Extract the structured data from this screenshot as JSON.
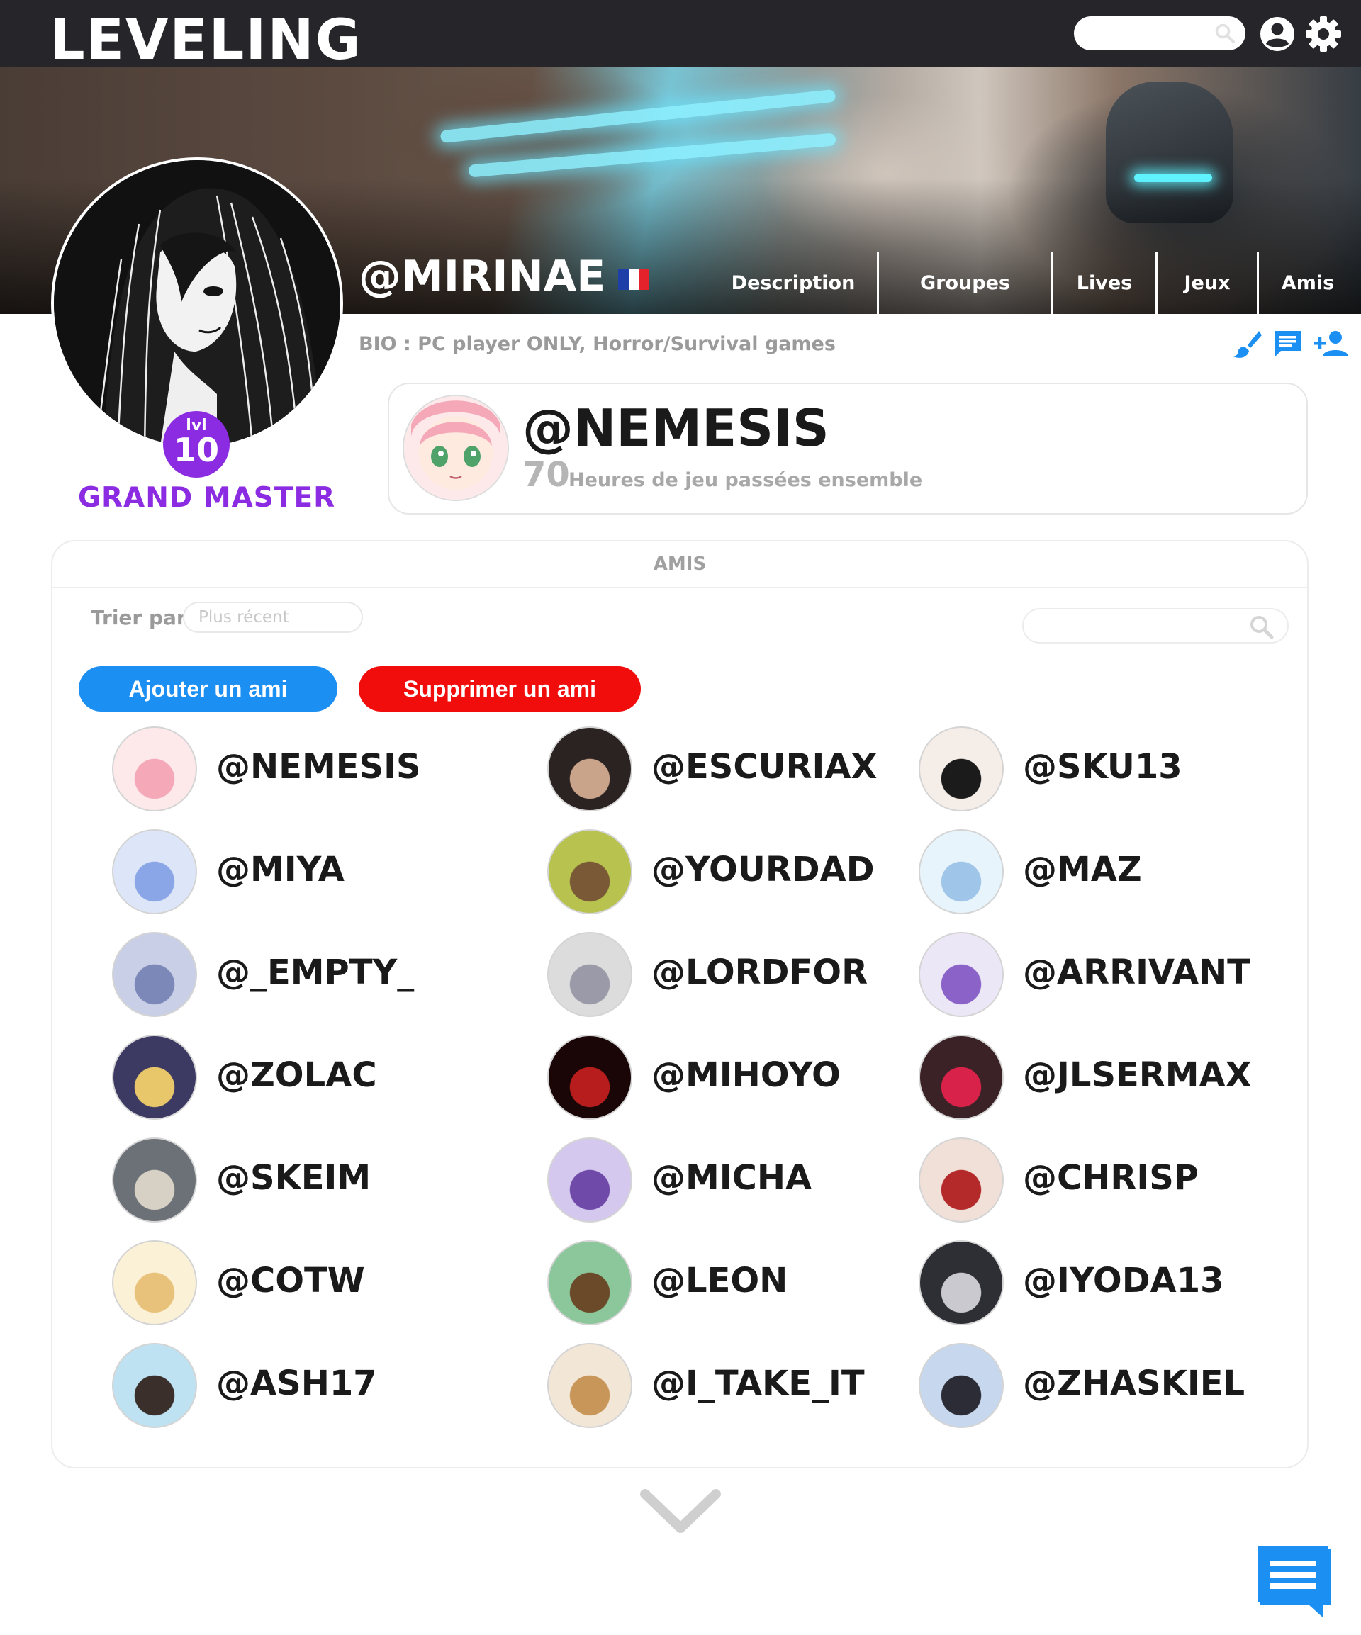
{
  "app": {
    "logo": "LEVELING"
  },
  "topbar": {
    "search_icon": "search-icon",
    "account_icon": "account-icon",
    "settings_icon": "gear-icon"
  },
  "profile": {
    "username": "@MIRINAE",
    "country_flag": "france-flag",
    "bio": "BIO : PC player ONLY, Horror/Survival games",
    "level_prefix": "lvl",
    "level": "10",
    "rank": "GRAND MASTER",
    "rank_color": "#8b2be2"
  },
  "nav": {
    "tabs": [
      {
        "label": "Description"
      },
      {
        "label": "Groupes"
      },
      {
        "label": "Lives"
      },
      {
        "label": "Jeux"
      },
      {
        "label": "Amis"
      }
    ]
  },
  "actions": {
    "edit_icon": "brush-icon",
    "message_icon": "message-icon",
    "add_friend_icon": "add-person-icon",
    "accent": "#1b8ff2"
  },
  "best_mate": {
    "name": "@NEMESIS",
    "hours": "70",
    "hours_label": "Heures de jeu passées ensemble"
  },
  "friends_panel": {
    "title": "AMIS",
    "sort_label": "Trier par",
    "sort_placeholder": "Plus récent",
    "search_placeholder": "",
    "add_button": "Ajouter un ami",
    "remove_button": "Supprimer un ami",
    "add_color": "#1b8ff2",
    "remove_color": "#f20d0d",
    "friends": [
      {
        "name": "@NEMESIS"
      },
      {
        "name": "@ESCURIAX"
      },
      {
        "name": "@SKU13"
      },
      {
        "name": "@MIYA"
      },
      {
        "name": "@YOURDAD"
      },
      {
        "name": "@MAZ"
      },
      {
        "name": "@_EMPTY_"
      },
      {
        "name": "@LORDFOR"
      },
      {
        "name": "@ARRIVANT"
      },
      {
        "name": "@ZOLAC"
      },
      {
        "name": "@MIHOYO"
      },
      {
        "name": "@JLSERMAX"
      },
      {
        "name": "@SKEIM"
      },
      {
        "name": "@MICHA"
      },
      {
        "name": "@CHRISP"
      },
      {
        "name": "@COTW"
      },
      {
        "name": "@LEON"
      },
      {
        "name": "@IYODA13"
      },
      {
        "name": "@ASH17"
      },
      {
        "name": "@I_TAKE_IT"
      },
      {
        "name": "@ZHASKIEL"
      }
    ]
  },
  "footer": {
    "more_icon": "chevron-down-icon",
    "chat_icon": "chat-icon"
  }
}
